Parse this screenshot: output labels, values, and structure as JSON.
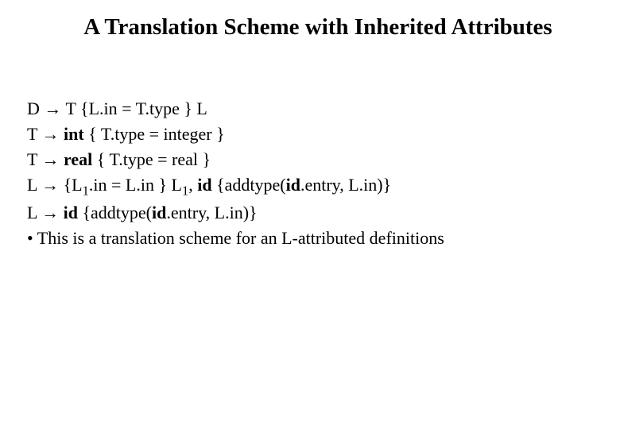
{
  "title": "A Translation Scheme with Inherited Attributes",
  "rules": {
    "r1": {
      "lhs": "D → T  {L.in = T.type } L"
    },
    "r2": {
      "lhs_pre": "T → ",
      "kw": "int",
      "rest": " { T.type = integer }"
    },
    "r3": {
      "lhs_pre": "T → ",
      "kw": "real",
      "rest": " { T.type = real }"
    },
    "r4": {
      "pre": "L → {L",
      "sub1": "1",
      "mid1": ".in = L.in } L",
      "sub2": "1",
      "mid2": ", ",
      "kw1": "id",
      "mid3": " {addtype(",
      "kw2": "id",
      "rest": ".entry, L.in)}"
    },
    "r5": {
      "pre": "L → ",
      "kw1": "id",
      "mid": " {addtype(",
      "kw2": "id",
      "rest": ".entry, L.in)}"
    }
  },
  "bullet": "• This is a translation scheme for an L-attributed definitions"
}
